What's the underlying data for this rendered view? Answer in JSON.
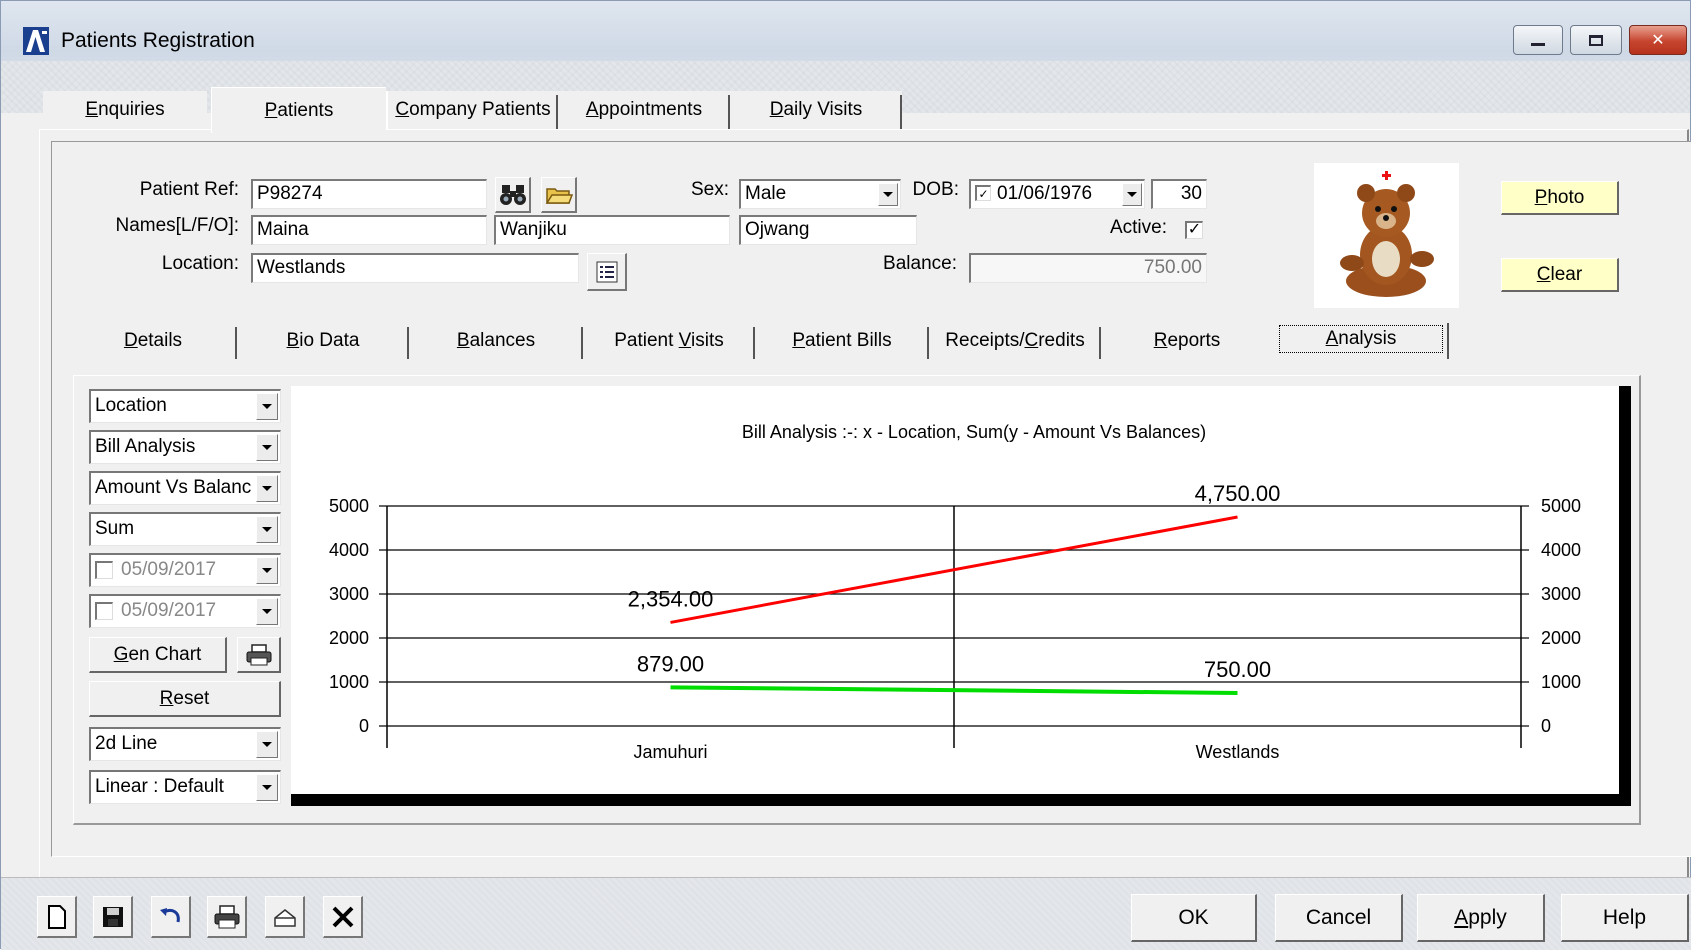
{
  "window": {
    "title": "Patients Registration"
  },
  "main_tabs": [
    {
      "label": "Enquiries",
      "accel": "E",
      "rest": "nquiries"
    },
    {
      "label": "Patients",
      "accel": "P",
      "rest": "atients"
    },
    {
      "label": "Company Patients",
      "accel": "C",
      "rest": "ompany Patients"
    },
    {
      "label": "Appointments",
      "accel": "A",
      "rest": "ppointments"
    },
    {
      "label": "Daily Visits",
      "accel": "D",
      "rest": "aily Visits"
    }
  ],
  "form": {
    "patient_ref_label": "Patient Ref:",
    "patient_ref": "P98274",
    "names_label": "Names[L/F/O]:",
    "name_last": "Maina",
    "name_first": "Wanjiku",
    "name_other": "Ojwang",
    "location_label": "Location:",
    "location": "Westlands",
    "sex_label": "Sex:",
    "sex": "Male",
    "dob_label": "DOB:",
    "dob": "01/06/1976",
    "dob_checked": true,
    "age": "30",
    "active_label": "Active:",
    "active": true,
    "balance_label": "Balance:",
    "balance": "750.00"
  },
  "side_buttons": {
    "photo": {
      "accel": "P",
      "rest": "hoto"
    },
    "clear": {
      "accel": "C",
      "rest": "lear"
    }
  },
  "sub_tabs": [
    {
      "pre": "",
      "accel": "D",
      "rest": "etails"
    },
    {
      "pre": "",
      "accel": "B",
      "rest": "io Data"
    },
    {
      "pre": "",
      "accel": "B",
      "rest": "alances"
    },
    {
      "pre": "Patient ",
      "accel": "V",
      "rest": "isits"
    },
    {
      "pre": "",
      "accel": "P",
      "rest": "atient Bills"
    },
    {
      "pre": "Receipts/",
      "accel": "C",
      "rest": "redits"
    },
    {
      "pre": "",
      "accel": "R",
      "rest": "eports"
    },
    {
      "pre": "",
      "accel": "A",
      "rest": "nalysis"
    }
  ],
  "analysis": {
    "group_by": "Location",
    "analysis_type": "Bill Analysis",
    "measure": "Amount Vs Balanc",
    "aggregate": "Sum",
    "date_from": "05/09/2017",
    "date_to": "05/09/2017",
    "gen_chart": {
      "accel": "G",
      "rest": "en Chart"
    },
    "reset": {
      "accel": "R",
      "rest": "eset"
    },
    "chart_style": "2d Line",
    "scale": "Linear : Default"
  },
  "chart_data": {
    "type": "line",
    "title": "Bill Analysis :-: x - Location, Sum(y - Amount Vs Balances)",
    "categories": [
      "Jamuhuri",
      "Westlands"
    ],
    "series": [
      {
        "values": [
          2354.0,
          4750.0
        ],
        "labels": [
          "2,354.00",
          "4,750.00"
        ],
        "color": "#ff0000"
      },
      {
        "values": [
          879.0,
          750.0
        ],
        "labels": [
          "879.00",
          "750.00"
        ],
        "color": "#00dd00"
      }
    ],
    "ylim": [
      0,
      5000
    ],
    "yticks": [
      "0",
      "1000",
      "2000",
      "3000",
      "4000",
      "5000"
    ],
    "grid": true,
    "secondary_y_axis": true
  },
  "footer": {
    "ok": "OK",
    "cancel": "Cancel",
    "apply": {
      "accel": "A",
      "rest": "pply"
    },
    "help": "Help"
  },
  "colors": {
    "photo_button_bg": "#ffffc8",
    "series_amount": "#ff0000",
    "series_balance": "#00dd00"
  }
}
